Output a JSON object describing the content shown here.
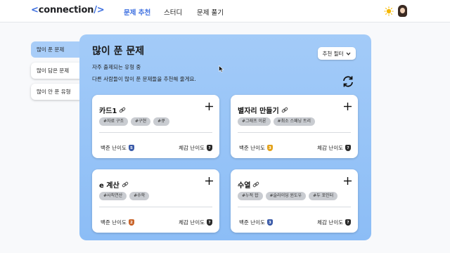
{
  "header": {
    "logo_open": "<",
    "logo_text": "connection",
    "logo_close": "/>",
    "nav": [
      "문제 추천",
      "스터디",
      "문제 풀기"
    ]
  },
  "sidebar": {
    "items": [
      {
        "label": "많이 푼 문제"
      },
      {
        "label": "많이 담은 문제"
      },
      {
        "label": "많이 안 푼 유형"
      }
    ]
  },
  "main": {
    "title": "많이 푼 문제",
    "subtitle1": "자주 출제되는 유형 중",
    "subtitle2": "다른 사람들이 많이 푼 문제들을 추천해 줄게요.",
    "filter_label": "추천 필터",
    "cards": [
      {
        "title": "카드1",
        "tags": [
          "#자료 구조",
          "#구현",
          "#큐"
        ],
        "baekjoon_label": "백준 난이도",
        "baekjoon_level": "5",
        "baekjoon_color": "#3a5aa8",
        "felt_label": "체감 난이도",
        "felt_level": "?",
        "felt_color": "#2a2a2a"
      },
      {
        "title": "별자리 만들기",
        "tags": [
          "#그래프 이론",
          "#최소 스패닝 트리"
        ],
        "baekjoon_label": "백준 난이도",
        "baekjoon_level": "3",
        "baekjoon_color": "#e3a21a",
        "felt_label": "체감 난이도",
        "felt_level": "?",
        "felt_color": "#2a2a2a"
      },
      {
        "title": "e 계산",
        "tags": [
          "#사칙연산",
          "#수학"
        ],
        "baekjoon_label": "백준 난이도",
        "baekjoon_level": "2",
        "baekjoon_color": "#c9642a",
        "felt_label": "체감 난이도",
        "felt_level": "?",
        "felt_color": "#2a2a2a"
      },
      {
        "title": "수열",
        "tags": [
          "#누적 합",
          "#슬라이딩 윈도우",
          "#두 포인터"
        ],
        "baekjoon_label": "백준 난이도",
        "baekjoon_level": "3",
        "baekjoon_color": "#3a5aa8",
        "felt_label": "체감 난이도",
        "felt_level": "?",
        "felt_color": "#2a2a2a"
      }
    ]
  },
  "colors": {
    "accent": "#3d6fe0",
    "panel": "#9cc7f8",
    "sidebar_active": "#a8cdf8"
  },
  "icons": [
    "sun-icon",
    "avatar",
    "chevron-down-icon",
    "refresh-icon",
    "link-icon",
    "plus-icon"
  ]
}
